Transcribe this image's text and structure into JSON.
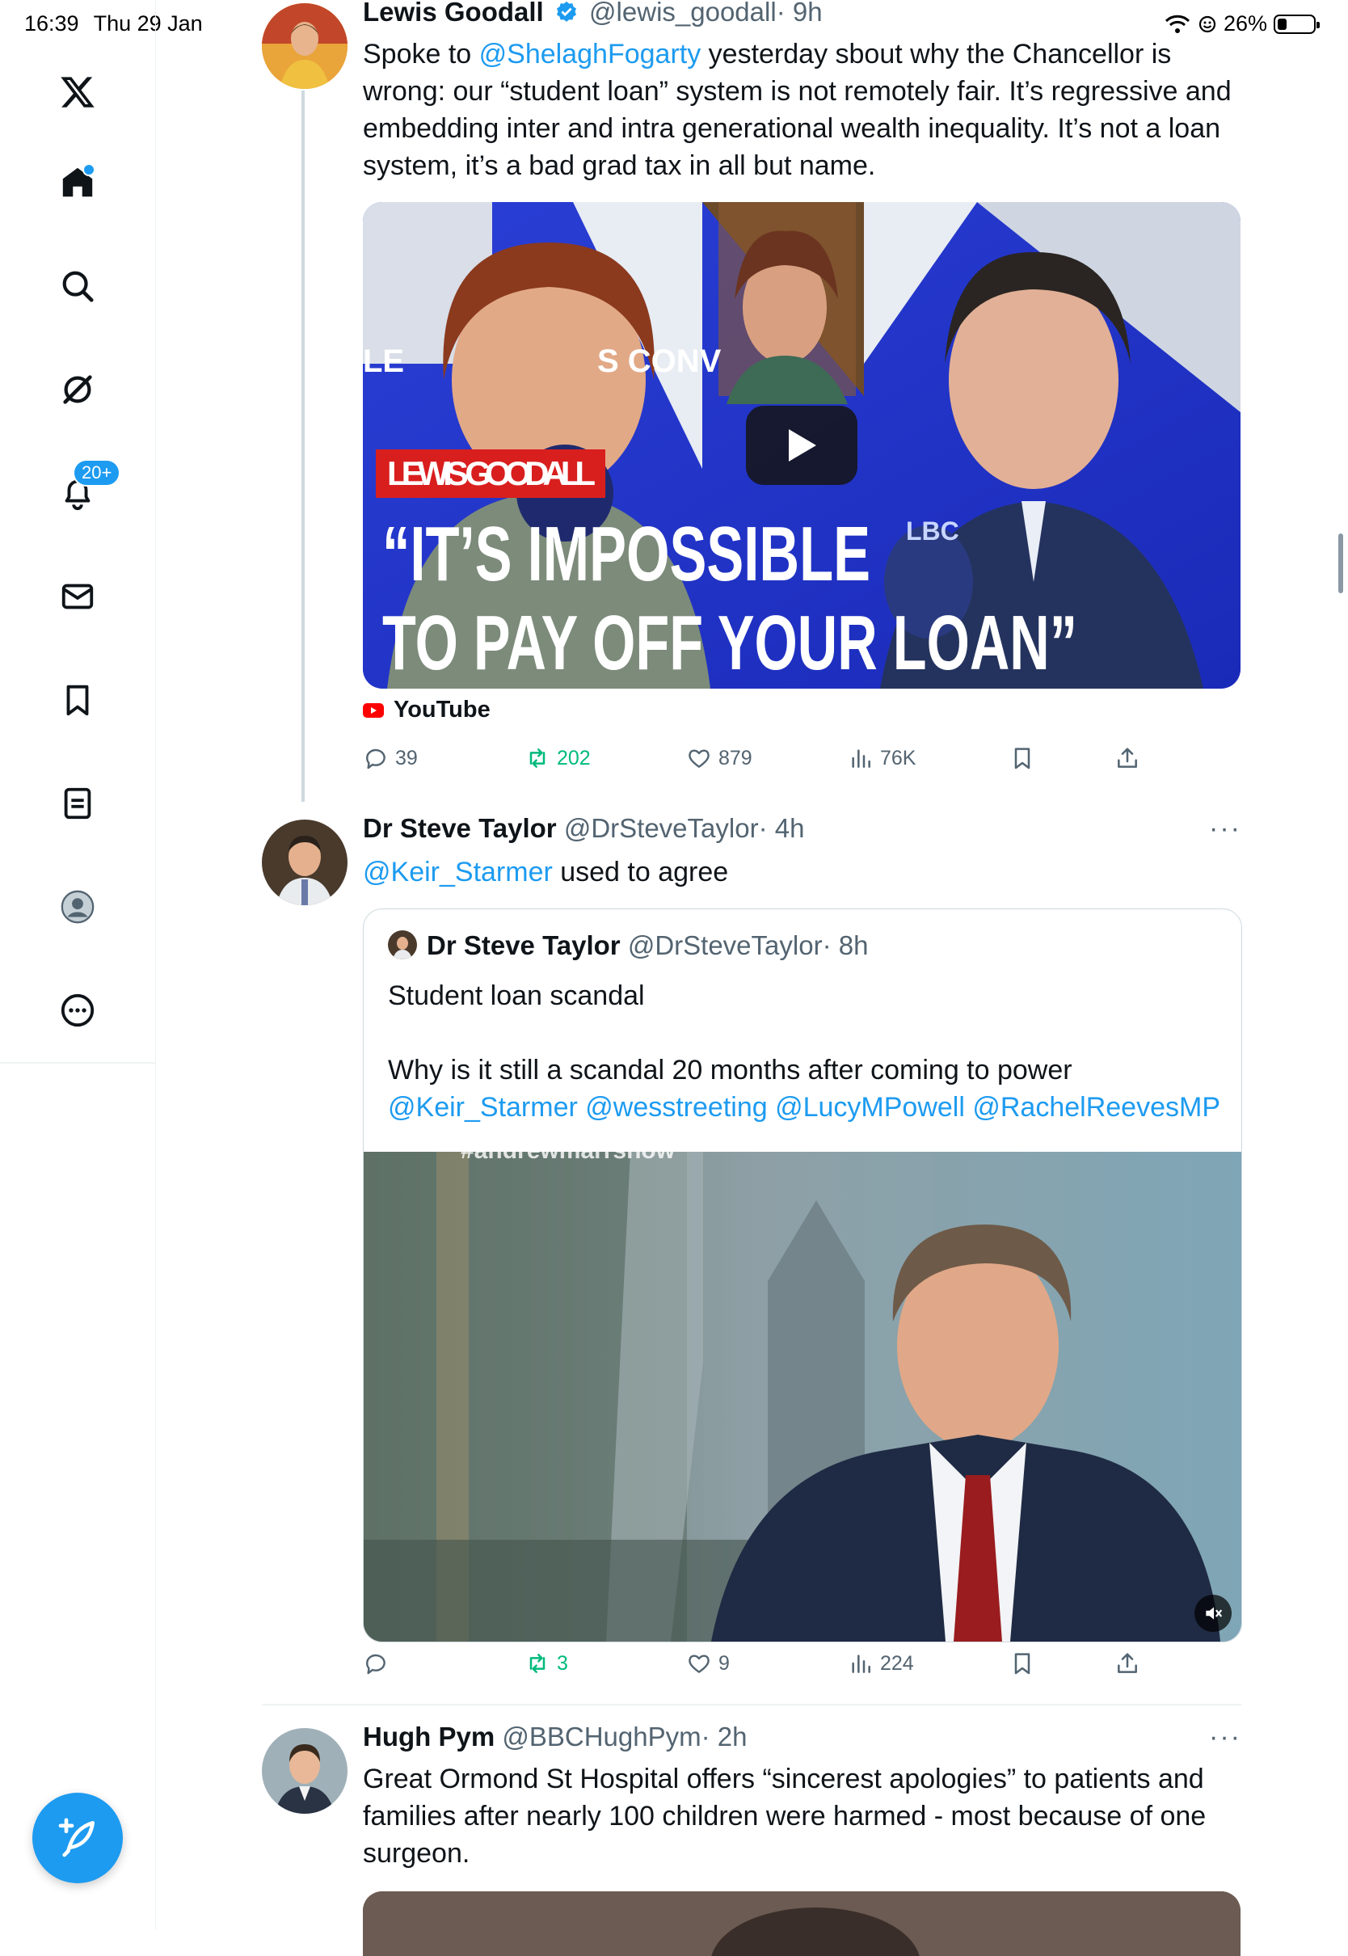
{
  "status_bar": {
    "time": "16:39",
    "date": "Thu 29 Jan",
    "battery": "26%",
    "battery_level": 0.26
  },
  "sidebar": {
    "notifications_badge": "20+"
  },
  "tweets": [
    {
      "name": "Lewis Goodall",
      "handle": "@lewis_goodall",
      "time": "· 9h",
      "text_mention": "@ShelaghFogarty",
      "text_pre": "Spoke to ",
      "text_post": " yesterday sbout why the Chancellor is wrong: our “student loan” system is not remotely fair. It’s regressive and embedding inter and intra generational wealth inequality. It’s not a loan system, it’s a bad grad tax in all but name.",
      "media": {
        "banner_name": "LEWIS GOODALL",
        "headline_1": "“IT’S IMPOSSIBLE",
        "headline_2": "TO PAY OFF YOUR LOAN”",
        "mic_logo": "LBC",
        "bg_text_1": "LE",
        "bg_text_2": "S CONV"
      },
      "source": "YouTube",
      "replies": "39",
      "retweets": "202",
      "likes": "879",
      "views": "76K"
    },
    {
      "name": "Dr Steve Taylor",
      "handle": "@DrSteveTaylor",
      "time": "· 4h",
      "text_mention": "@Keir_Starmer",
      "text_post": " used to agree",
      "more": "···",
      "quote": {
        "name": "Dr Steve Taylor",
        "handle": "@DrSteveTaylor",
        "time": "· 8h",
        "line1": "Student loan scandal",
        "line2": "Why is it still a scandal 20 months after coming to power",
        "mentions": [
          "@Keir_Starmer",
          "@wesstreeting",
          "@LucyMPowell",
          "@RachelReevesMP"
        ],
        "video_overlay_text": "#andrewmarrshow"
      },
      "replies": "",
      "retweets": "3",
      "likes": "9",
      "views": "224"
    },
    {
      "name": "Hugh Pym",
      "handle": "@BBCHughPym",
      "time": "· 2h",
      "text": "Great Ormond St Hospital offers “sincerest apologies” to patients and families after nearly 100 children were harmed - most because of one surgeon.",
      "more": "···"
    }
  ],
  "colors": {
    "accent": "#1d9bf0",
    "green": "#00ba7c",
    "muted": "#536471"
  }
}
